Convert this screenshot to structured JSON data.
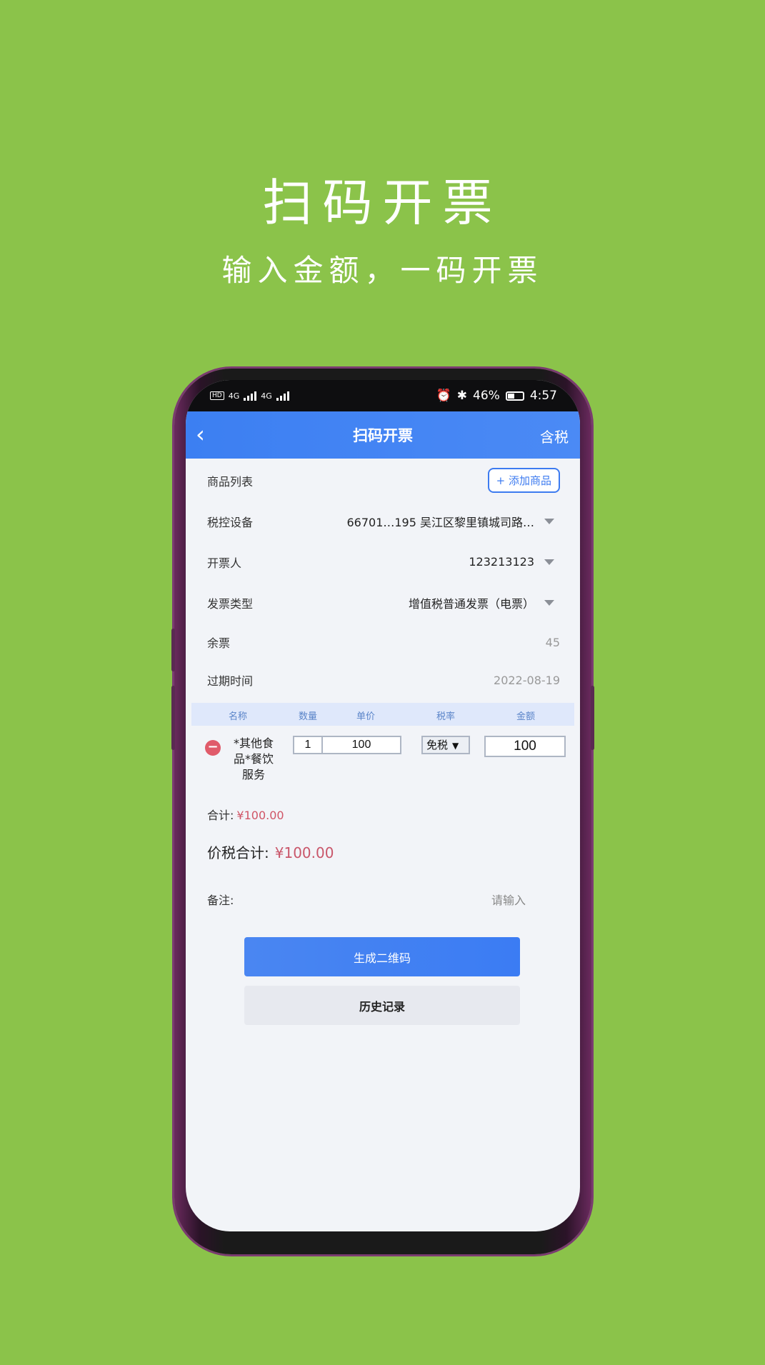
{
  "promo": {
    "title": "扫码开票",
    "subtitle": "输入金额，一码开票"
  },
  "status_bar": {
    "left_tags": [
      "HD",
      "HD"
    ],
    "network_1": "4G",
    "network_2": "4G",
    "battery_text": "46%",
    "battery_level": 0.46,
    "time": "4:57"
  },
  "navbar": {
    "back_icon": "chevron-left-icon",
    "back_glyph": "‹",
    "title": "扫码开票",
    "right": "含税"
  },
  "form": {
    "product_list_label": "商品列表",
    "add_product_button": "+ 添加商品",
    "tax_device_label": "税控设备",
    "tax_device_value": "66701…195 吴江区黎里镇城司路…",
    "issuer_label": "开票人",
    "issuer_value": "123213123",
    "invoice_type_label": "发票类型",
    "invoice_type_value": "增值税普通发票（电票）",
    "remaining_label": "余票",
    "remaining_value": "45",
    "expiry_label": "过期时间",
    "expiry_value": "2022-08-19"
  },
  "table": {
    "headers": [
      "名称",
      "数量",
      "单价",
      "税率",
      "金额"
    ],
    "rows": [
      {
        "name": "*其他食品*餐饮服务",
        "quantity": "1",
        "unit_price": "100",
        "tax_rate": "免税",
        "amount": "100"
      }
    ]
  },
  "totals": {
    "subtotal_label": "合计:",
    "subtotal_value": "¥100.00",
    "grand_label": "价税合计:",
    "grand_value": "¥100.00"
  },
  "remark": {
    "label": "备注:",
    "placeholder": "请输入"
  },
  "buttons": {
    "generate_qr": "生成二维码",
    "history": "历史记录"
  },
  "colors": {
    "background": "#8bc34a",
    "primary": "#3d7bf0",
    "price": "#c9566a"
  }
}
